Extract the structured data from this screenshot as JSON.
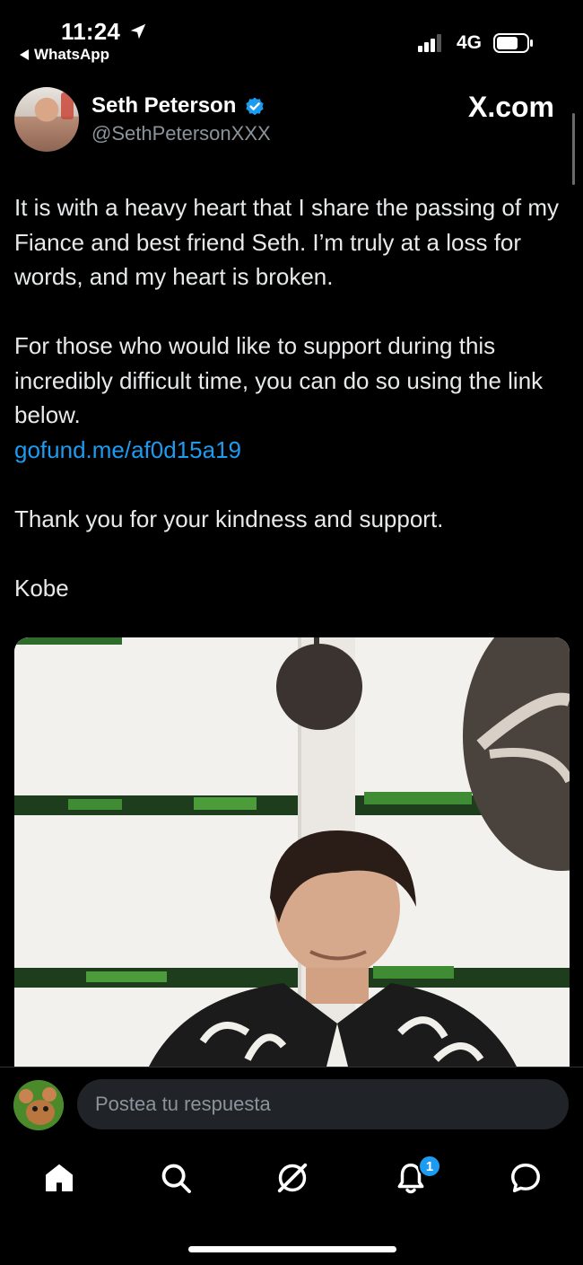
{
  "status_bar": {
    "time": "11:24",
    "back_app": "WhatsApp",
    "network": "4G",
    "location_icon": "location-arrow-icon",
    "signal_icon": "signal-bars-icon",
    "battery_icon": "battery-icon"
  },
  "tweet": {
    "author": {
      "display_name": "Seth Peterson",
      "handle": "@SethPetersonXXX",
      "verified_icon": "verified-badge-icon"
    },
    "site_label": "X.com",
    "paragraphs": [
      "It is with a heavy heart that I share the passing of my Fiance and best friend Seth.  I’m truly at a loss for words, and my heart is broken.",
      "For those who would like to support during this incredibly difficult time, you can do so using the link below."
    ],
    "link": "gofund.me/af0d15a19",
    "thanks": "Thank you for your kindness and support.",
    "signature": "Kobe"
  },
  "reply": {
    "placeholder": "Postea tu respuesta"
  },
  "tab_bar": {
    "items": [
      {
        "name": "home",
        "icon": "home-icon"
      },
      {
        "name": "search",
        "icon": "search-icon"
      },
      {
        "name": "grok",
        "icon": "grok-icon"
      },
      {
        "name": "notifications",
        "icon": "bell-icon"
      },
      {
        "name": "messages",
        "icon": "message-bubble-icon"
      }
    ],
    "notification_count": "1"
  },
  "colors": {
    "background": "#000000",
    "text": "#e7e9ea",
    "muted": "#8b949b",
    "link": "#1d9bf0"
  }
}
